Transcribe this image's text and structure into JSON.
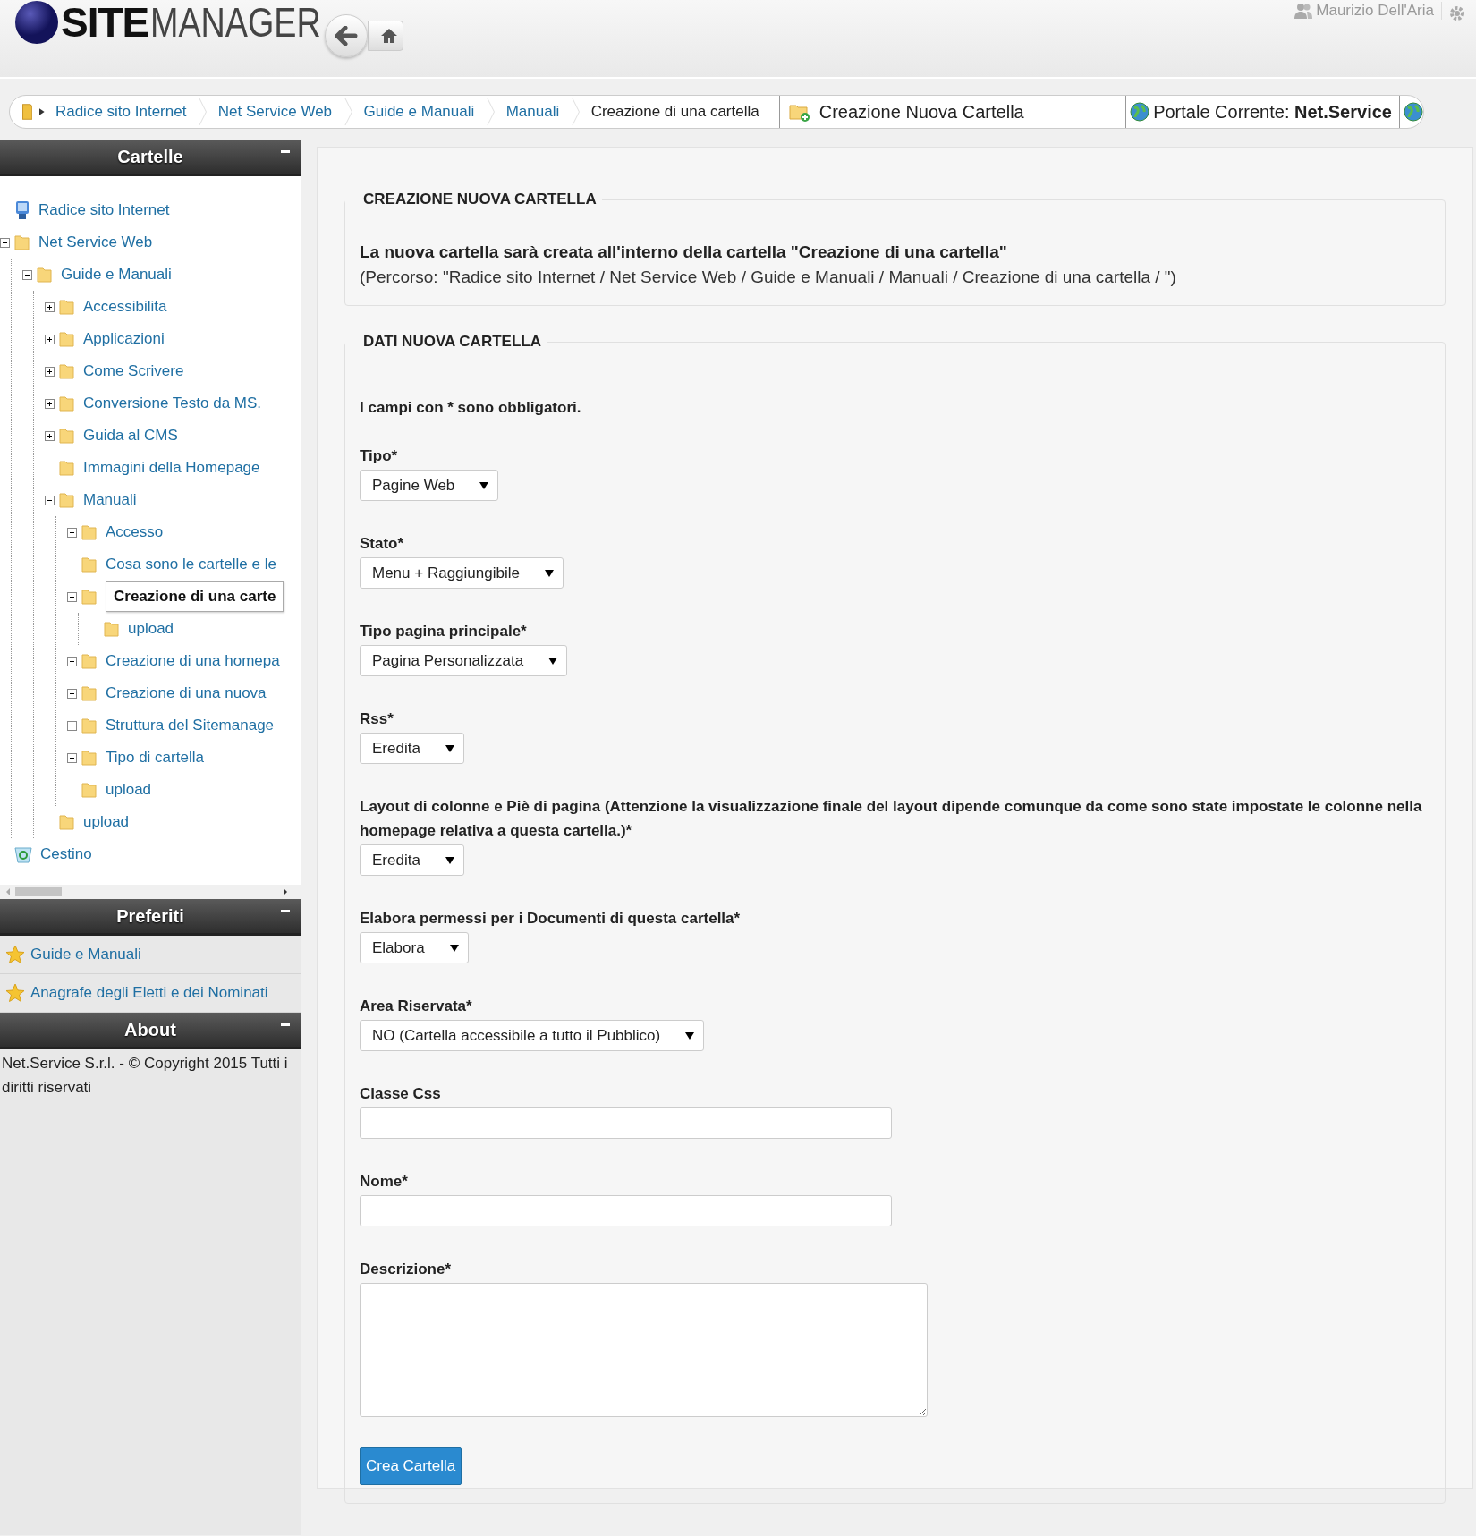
{
  "header": {
    "logo": {
      "bold": "SITE",
      "light": "MANAGER"
    },
    "user": "Maurizio Dell'Aria"
  },
  "breadcrumb": {
    "items": [
      {
        "label": "Radice sito Internet",
        "current": false
      },
      {
        "label": "Net Service Web",
        "current": false
      },
      {
        "label": "Guide e Manuali",
        "current": false
      },
      {
        "label": "Manuali",
        "current": false
      },
      {
        "label": "Creazione di una cartella",
        "current": true
      }
    ],
    "page_title": "Creazione Nuova Cartella",
    "portal": "Portale Corrente: **Net.Service**"
  },
  "sidebar": {
    "folders": {
      "title": "Cartelle",
      "tree": [
        {
          "label": "Radice sito Internet",
          "kind": "root",
          "selected": false
        },
        {
          "label": "Net Service Web",
          "kind": "branch",
          "expanded": true,
          "selected": false,
          "children": [
            {
              "label": "Guide e Manuali",
              "kind": "branch",
              "expanded": true,
              "selected": false,
              "children": [
                {
                  "label": "Accessibilita",
                  "kind": "branch",
                  "expanded": false,
                  "selected": false
                },
                {
                  "label": "Applicazioni",
                  "kind": "branch",
                  "expanded": false,
                  "selected": false
                },
                {
                  "label": "Come Scrivere",
                  "kind": "branch",
                  "expanded": false,
                  "selected": false
                },
                {
                  "label": "Conversione Testo da MS.",
                  "kind": "branch",
                  "expanded": false,
                  "selected": false
                },
                {
                  "label": "Guida al CMS",
                  "kind": "branch",
                  "expanded": false,
                  "selected": false
                },
                {
                  "label": "Immagini della Homepage",
                  "kind": "leaf",
                  "selected": false
                },
                {
                  "label": "Manuali",
                  "kind": "branch",
                  "expanded": true,
                  "selected": false,
                  "children": [
                    {
                      "label": "Accesso",
                      "kind": "branch",
                      "expanded": false,
                      "selected": false
                    },
                    {
                      "label": "Cosa sono le cartelle e le",
                      "kind": "leaf",
                      "selected": false
                    },
                    {
                      "label": "Creazione di una carte",
                      "kind": "branch",
                      "expanded": true,
                      "selected": true,
                      "children": [
                        {
                          "label": "upload",
                          "kind": "leaf",
                          "selected": false
                        }
                      ]
                    },
                    {
                      "label": "Creazione di una homepa",
                      "kind": "branch",
                      "expanded": false,
                      "selected": false
                    },
                    {
                      "label": "Creazione di una nuova",
                      "kind": "branch",
                      "expanded": false,
                      "selected": false
                    },
                    {
                      "label": "Struttura del Sitemanage",
                      "kind": "branch",
                      "expanded": false,
                      "selected": false
                    },
                    {
                      "label": "Tipo di cartella",
                      "kind": "branch",
                      "expanded": false,
                      "selected": false
                    },
                    {
                      "label": "upload",
                      "kind": "leaf",
                      "selected": false
                    }
                  ]
                },
                {
                  "label": "upload",
                  "kind": "leaf",
                  "selected": false
                }
              ]
            }
          ]
        },
        {
          "label": "Cestino",
          "kind": "trash",
          "selected": false
        }
      ]
    },
    "favorites": {
      "title": "Preferiti",
      "items": [
        "Guide e Manuali",
        "Anagrafe degli Eletti e dei Nominati"
      ]
    },
    "about": {
      "title": "About",
      "text": "Net.Service S.r.l. - © Copyright 2015 Tutti i diritti riservati"
    }
  },
  "main": {
    "intro": {
      "title": "CREAZIONE NUOVA CARTELLA",
      "message": "La nuova cartella sarà creata all'interno della cartella \"Creazione di una cartella\"",
      "path": "(Percorso: \"Radice sito Internet / Net Service Web / Guide e Manuali / Manuali / Creazione di una cartella / \")"
    },
    "form": {
      "title": "DATI NUOVA CARTELLA",
      "note": "I campi con * sono obbligatori.",
      "fields": [
        {
          "label": "Tipo*",
          "kind": "select",
          "value": "Pagine Web"
        },
        {
          "label": "Stato*",
          "kind": "select",
          "value": "Menu + Raggiungibile"
        },
        {
          "label": "Tipo pagina principale*",
          "kind": "select",
          "value": "Pagina Personalizzata"
        },
        {
          "label": "Rss*",
          "kind": "select",
          "value": "Eredita"
        },
        {
          "label": "Layout di colonne e Piè di pagina (Attenzione la visualizzazione finale del layout dipende comunque da come sono state impostate le colonne nella homepage relativa a questa cartella.)*",
          "kind": "select",
          "value": "Eredita"
        },
        {
          "label": "Elabora permessi per i Documenti di questa cartella*",
          "kind": "select",
          "value": "Elabora"
        },
        {
          "label": "Area Riservata*",
          "kind": "select",
          "value": "NO (Cartella accessibile a tutto il Pubblico)"
        },
        {
          "label": "Classe Css",
          "kind": "text"
        },
        {
          "label": "Nome*",
          "kind": "text"
        },
        {
          "label": "Descrizione*",
          "kind": "textarea"
        }
      ],
      "submit": "Crea Cartella"
    }
  }
}
